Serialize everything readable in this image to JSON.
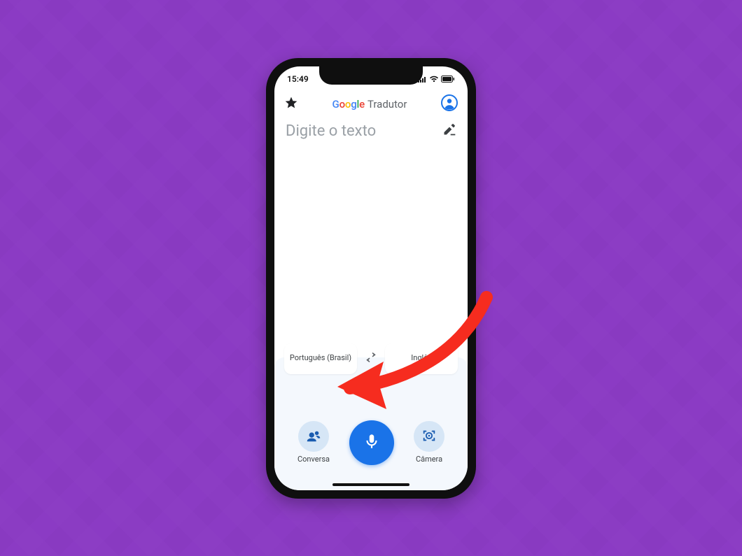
{
  "status_bar": {
    "time": "15:49"
  },
  "header": {
    "google_logo_letters": [
      "G",
      "o",
      "o",
      "g",
      "l",
      "e"
    ],
    "app_name": "Tradutor"
  },
  "input": {
    "placeholder": "Digite o texto"
  },
  "languages": {
    "source": "Português (Brasil)",
    "target": "Inglês"
  },
  "actions": {
    "conversation_label": "Conversa",
    "camera_label": "Câmera"
  },
  "colors": {
    "background": "#8b3bc4",
    "accent_blue": "#1a73e8",
    "annotation_red": "#f62c1f"
  }
}
